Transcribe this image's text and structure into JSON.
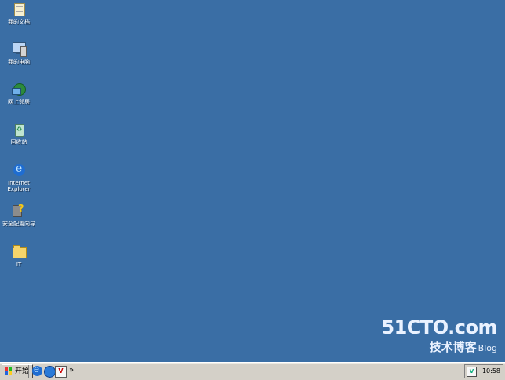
{
  "desktop": {
    "background_color": "#3a6ea5",
    "icons": [
      {
        "label": "我的文档",
        "icon": "my-documents-icon"
      },
      {
        "label": "我的电脑",
        "icon": "my-computer-icon"
      },
      {
        "label": "网上邻居",
        "icon": "network-places-icon"
      },
      {
        "label": "回收站",
        "icon": "recycle-bin-icon"
      },
      {
        "label": "Internet\nExplorer",
        "icon": "internet-explorer-icon"
      },
      {
        "label": "安全配置向导",
        "icon": "security-wizard-icon"
      },
      {
        "label": "IT",
        "icon": "folder-icon"
      }
    ]
  },
  "watermark": {
    "site": "51CTO.com",
    "subtitle": "技术博客",
    "blog": "Blog"
  },
  "taskbar": {
    "start_label": "开始",
    "quick_launch": [
      "internet-explorer-icon",
      "browser-icon",
      "app-v-icon"
    ],
    "overflow": "»",
    "tray": {
      "app_icon_text": "V",
      "clock": "10:58"
    }
  }
}
